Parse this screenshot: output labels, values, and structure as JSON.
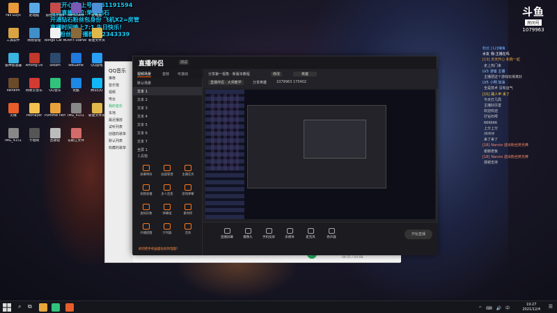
{
  "overlay_lines": [
    "天天开心哦 上号Q361191594",
    "当前直播段位:荣耀钻石",
    "开通钻石粉丝包身份 飞机X2=房管",
    "直播时间晚上7:1 生日快乐！",
    "7级粉丝牌开播群222343339"
  ],
  "logo": {
    "mark": "斗鱼",
    "tag": "房间号",
    "room_id": "1079963"
  },
  "desktop_icons": [
    {
      "label": "Fall Guys",
      "color": "#e89a3c"
    },
    {
      "label": "此电脑",
      "color": "#5aa9e6"
    },
    {
      "label": "冒险岛小窗V",
      "color": "#c84b4b"
    },
    {
      "label": "RoHClient",
      "color": "#7a5ab5"
    },
    {
      "label": "此电脑",
      "color": "#4c8fd6"
    },
    {
      "label": "工具软件",
      "color": "#d9a441"
    },
    {
      "label": "网络管理",
      "color": "#3f8fc9"
    },
    {
      "label": "Bongo Cat Mver",
      "color": "#f2f2f2"
    },
    {
      "label": "Don't Starve",
      "color": "#8a6a3a"
    },
    {
      "label": "新建文件夹",
      "color": "#e0b84a"
    },
    {
      "label": "雷神加速器",
      "color": "#3bb3e0"
    },
    {
      "label": "Among Us",
      "color": "#c0392b"
    },
    {
      "label": "Steam",
      "color": "#2c4a6e"
    },
    {
      "label": "WeGame",
      "color": "#1f7adb"
    },
    {
      "label": "QQ游戏",
      "color": "#2a9df4"
    },
    {
      "label": "Valheim",
      "color": "#6b4a2a"
    },
    {
      "label": "网易云音乐",
      "color": "#d33a31"
    },
    {
      "label": "QQ音乐",
      "color": "#31c27c"
    },
    {
      "label": "优酷",
      "color": "#1e88e5"
    },
    {
      "label": "腾讯QQ",
      "color": "#12b7f5"
    },
    {
      "label": "火绒",
      "color": "#e85d2a"
    },
    {
      "label": "PotPlayer",
      "color": "#f2c14e"
    },
    {
      "label": "Pummel Party",
      "color": "#e9a23b"
    },
    {
      "label": "IMG_4151",
      "color": "#888888"
    },
    {
      "label": "新建文件夹",
      "color": "#e0b84a"
    },
    {
      "label": "IMG_4151",
      "color": "#888888"
    },
    {
      "label": "卡暗网",
      "color": "#555555"
    },
    {
      "label": "回收站",
      "color": "#bcbcbc"
    },
    {
      "label": "花助江文件",
      "color": "#d46b6b"
    }
  ],
  "qq_music": {
    "logo": "QQ音乐",
    "nav": [
      "推荐",
      "音乐馆",
      "视频",
      "电台",
      "我的音乐",
      "本地",
      "最近播放",
      "试听列表",
      "创建的歌单",
      "默认列表",
      "收藏的歌单"
    ],
    "active_nav": "我的音乐",
    "play_icon": "▶",
    "time": "04:55 / 04:08"
  },
  "streamer": {
    "brand": "直播伴侣",
    "brand_tag": "测试",
    "tabs": [
      "视频场景",
      "音效",
      "可滚动"
    ],
    "scenes": [
      "默认场景",
      "文本 1",
      "文本 2",
      "文本 3",
      "文本 4",
      "文本 5",
      "文本 6",
      "文本 7",
      "全屏 1"
    ],
    "selected_scene": 1,
    "tools_title": "工具箱",
    "tools": [
      "屏幕特效",
      "画面管理",
      "主播任务",
      "视频直播",
      "多人连麦",
      "游戏弹幕",
      "虚拟形象",
      "弹幕墙",
      "素材库",
      "开播提醒",
      "计时器",
      "音效"
    ],
    "tip": "如何把手机画面投屏到电脑?",
    "stream_name": "分享第一视角 · 新版本教程",
    "btn_edit": "修改",
    "btn_cat": "英雄",
    "category": "直播伴侣 · 大师教学",
    "room_name": "分享英雄",
    "room_id": "1079963",
    "hot": "175402",
    "bottom": [
      "直播屏幕",
      "摄像头",
      "手机投屏",
      "多媒体",
      "麦克风",
      "扬声器"
    ],
    "go_live": "开始直播"
  },
  "chat": [
    {
      "u": "粉丝",
      "t": "[12]嗨嗨",
      "c": "#6fb0ff"
    },
    {
      "u": "水友",
      "t": "我:主播在吗",
      "c": "#ffffff"
    },
    {
      "u": "[13]",
      "t": "天天开心 和我一起",
      "c": "#e9a23b"
    },
    {
      "u": "",
      "t": "走上热门来",
      "c": "#cfcfcf"
    },
    {
      "u": "LV3",
      "t": "游客 主播",
      "c": "#9cc7ff"
    },
    {
      "u": "",
      "t": "主播把这个游戏玩得真好",
      "c": "#cfcfcf"
    },
    {
      "u": "LV5",
      "t": "小明 加油",
      "c": "#9cc7ff"
    },
    {
      "u": "",
      "t": "全是技术 没有运气",
      "c": "#cfcfcf"
    },
    {
      "u": "[15]",
      "t": "路人甲 来了",
      "c": "#ffcc33"
    },
    {
      "u": "",
      "t": "今天打几局",
      "c": "#cfcfcf"
    },
    {
      "u": "",
      "t": "主播好厉害",
      "c": "#cfcfcf"
    },
    {
      "u": "",
      "t": "欢迎欢迎",
      "c": "#cfcfcf"
    },
    {
      "u": "",
      "t": "打钻石呀",
      "c": "#cfcfcf"
    },
    {
      "u": "",
      "t": "666666",
      "c": "#cfcfcf"
    },
    {
      "u": "",
      "t": "上分上分",
      "c": "#cfcfcf"
    },
    {
      "u": "",
      "t": "冲冲冲",
      "c": "#cfcfcf"
    },
    {
      "u": "",
      "t": "来了来了",
      "c": "#cfcfcf"
    },
    {
      "u": "[18]",
      "t": "Naruto 送出粉丝荧光棒",
      "c": "#ff8a66"
    },
    {
      "u": "",
      "t": "谢谢老板",
      "c": "#cfcfcf"
    },
    {
      "u": "[18]",
      "t": "Naruto 送出粉丝荧光棒",
      "c": "#ff8a66"
    },
    {
      "u": "",
      "t": "感谢支持",
      "c": "#cfcfcf"
    }
  ],
  "taskbar": {
    "search": "⌕",
    "view": "⧉",
    "tray": "^ ⌨ 🔊 中",
    "time": "19:27",
    "date": "2021/12/4",
    "notif": "☰"
  }
}
